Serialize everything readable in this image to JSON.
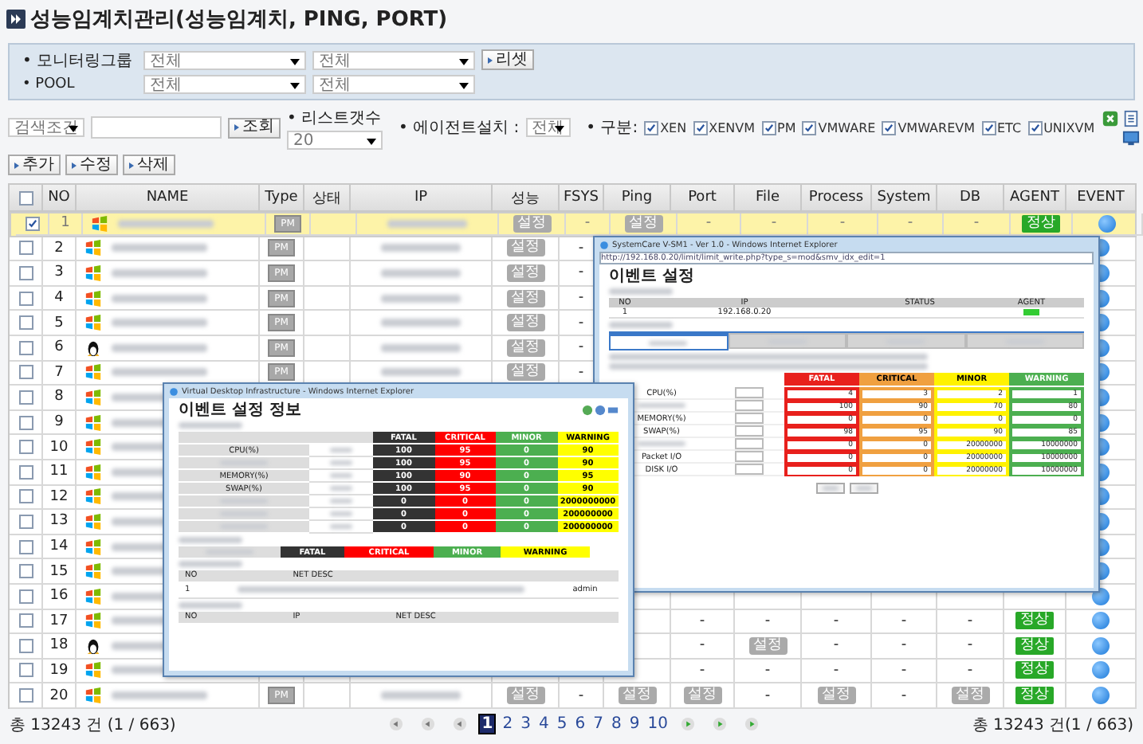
{
  "title": "성능임계치관리(성능임계치, PING, PORT)",
  "filters": {
    "group_label": "• 모니터링그룹",
    "group_selects": [
      "전체",
      "전체"
    ],
    "reset_button": "리셋",
    "pool_label": "• POOL",
    "pool_selects": [
      "전체",
      "전체"
    ]
  },
  "search": {
    "condition": "검색조건",
    "search_button": "조회",
    "list_count_label": "• 리스트갯수",
    "list_count": "20",
    "agent_label": "• 에이전트설치 :",
    "agent_value": "전체",
    "category_label": "• 구분:",
    "categories": [
      {
        "label": "XEN",
        "checked": true
      },
      {
        "label": "XENVM",
        "checked": true
      },
      {
        "label": "PM",
        "checked": true
      },
      {
        "label": "VMWARE",
        "checked": true
      },
      {
        "label": "VMWAREVM",
        "checked": true
      },
      {
        "label": "ETC",
        "checked": true
      },
      {
        "label": "UNIXVM",
        "checked": true
      }
    ]
  },
  "actions": [
    "추가",
    "수정",
    "삭제"
  ],
  "table": {
    "header_checked": false,
    "columns": [
      "NO",
      "NAME",
      "Type",
      "상태",
      "IP",
      "성능",
      "FSYS",
      "Ping",
      "Port",
      "File",
      "Process",
      "System",
      "DB",
      "AGENT",
      "EVENT"
    ],
    "rows": [
      {
        "no": "1",
        "checked": true,
        "selected": true,
        "kind": "windows",
        "type": "PM",
        "checks": {
          "perf": {
            "text": "설정",
            "kind": "badge"
          },
          "fsys": {
            "text": "-",
            "kind": "plain"
          },
          "ping": {
            "text": "설정",
            "kind": "badge"
          },
          "port": {
            "text": "-",
            "kind": "plain"
          },
          "file": {
            "text": "-",
            "kind": "plain"
          },
          "process": {
            "text": "-",
            "kind": "plain"
          },
          "system": {
            "text": "-",
            "kind": "plain"
          },
          "db": {
            "text": "-",
            "kind": "plain"
          }
        },
        "agent": "정상",
        "event": true
      },
      {
        "no": "2",
        "checked": false,
        "selected": false,
        "kind": "windows",
        "type": "PM",
        "checks": {
          "perf": {
            "text": "설정",
            "kind": "badge"
          },
          "fsys": {
            "text": "-",
            "kind": "plain"
          }
        },
        "event": true
      },
      {
        "no": "3",
        "checked": false,
        "selected": false,
        "kind": "windows",
        "type": "PM",
        "checks": {
          "perf": {
            "text": "설정",
            "kind": "badge"
          },
          "fsys": {
            "text": "-",
            "kind": "plain"
          }
        },
        "event": true
      },
      {
        "no": "4",
        "checked": false,
        "selected": false,
        "kind": "windows",
        "type": "PM",
        "checks": {
          "perf": {
            "text": "설정",
            "kind": "badge"
          },
          "fsys": {
            "text": "-",
            "kind": "plain"
          }
        },
        "event": true
      },
      {
        "no": "5",
        "checked": false,
        "selected": false,
        "kind": "windows",
        "type": "PM",
        "checks": {
          "perf": {
            "text": "설정",
            "kind": "badge"
          },
          "fsys": {
            "text": "-",
            "kind": "plain"
          }
        },
        "event": true
      },
      {
        "no": "6",
        "checked": false,
        "selected": false,
        "kind": "linux",
        "type": "PM",
        "checks": {
          "perf": {
            "text": "설정",
            "kind": "badge"
          },
          "fsys": {
            "text": "-",
            "kind": "plain"
          }
        },
        "event": true
      },
      {
        "no": "7",
        "checked": false,
        "selected": false,
        "kind": "windows",
        "type": "PM",
        "checks": {
          "perf": {
            "text": "설정",
            "kind": "badge"
          },
          "fsys": {
            "text": "-",
            "kind": "plain"
          }
        },
        "event": true
      },
      {
        "no": "8",
        "checked": false,
        "selected": false,
        "kind": "windows",
        "event": true
      },
      {
        "no": "9",
        "checked": false,
        "selected": false,
        "kind": "windows",
        "event": true
      },
      {
        "no": "10",
        "checked": false,
        "selected": false,
        "kind": "windows",
        "event": true
      },
      {
        "no": "11",
        "checked": false,
        "selected": false,
        "kind": "windows",
        "event": true
      },
      {
        "no": "12",
        "checked": false,
        "selected": false,
        "kind": "windows",
        "event": true
      },
      {
        "no": "13",
        "checked": false,
        "selected": false,
        "kind": "windows",
        "event": true
      },
      {
        "no": "14",
        "checked": false,
        "selected": false,
        "kind": "windows",
        "event": true
      },
      {
        "no": "15",
        "checked": false,
        "selected": false,
        "kind": "windows",
        "event": true
      },
      {
        "no": "16",
        "checked": false,
        "selected": false,
        "kind": "windows",
        "event": true
      },
      {
        "no": "17",
        "checked": false,
        "selected": false,
        "kind": "windows",
        "checks": {
          "port": {
            "text": "-",
            "kind": "plain"
          },
          "file": {
            "text": "-",
            "kind": "plain"
          },
          "process": {
            "text": "-",
            "kind": "plain"
          },
          "system": {
            "text": "-",
            "kind": "plain"
          },
          "db": {
            "text": "-",
            "kind": "plain"
          }
        },
        "agent": "정상",
        "event": true
      },
      {
        "no": "18",
        "checked": false,
        "selected": false,
        "kind": "linux",
        "checks": {
          "port": {
            "text": "-",
            "kind": "plain"
          },
          "file": {
            "text": "설정",
            "kind": "badge"
          },
          "process": {
            "text": "-",
            "kind": "plain"
          },
          "system": {
            "text": "-",
            "kind": "plain"
          },
          "db": {
            "text": "-",
            "kind": "plain"
          }
        },
        "agent": "정상",
        "event": true
      },
      {
        "no": "19",
        "checked": false,
        "selected": false,
        "kind": "windows",
        "checks": {
          "port": {
            "text": "-",
            "kind": "plain"
          },
          "file": {
            "text": "-",
            "kind": "plain"
          },
          "process": {
            "text": "-",
            "kind": "plain"
          },
          "system": {
            "text": "-",
            "kind": "plain"
          },
          "db": {
            "text": "-",
            "kind": "plain"
          }
        },
        "agent": "정상",
        "event": true
      },
      {
        "no": "20",
        "checked": false,
        "selected": false,
        "kind": "windows",
        "type": "PM",
        "checks": {
          "perf": {
            "text": "설정",
            "kind": "badge"
          },
          "fsys": {
            "text": "-",
            "kind": "plain"
          },
          "ping": {
            "text": "설정",
            "kind": "badge"
          },
          "port": {
            "text": "설정",
            "kind": "badge"
          },
          "file": {
            "text": "-",
            "kind": "plain"
          },
          "process": {
            "text": "설정",
            "kind": "badge"
          },
          "system": {
            "text": "-",
            "kind": "plain"
          },
          "db": {
            "text": "설정",
            "kind": "badge"
          }
        },
        "agent": "정상",
        "event": true
      }
    ]
  },
  "footer": {
    "total_left": "총 13243 건 (1 / 663)",
    "pages": [
      {
        "label": "1",
        "selected": true
      },
      {
        "label": "2",
        "selected": false
      },
      {
        "label": "3",
        "selected": false
      },
      {
        "label": "4",
        "selected": false
      },
      {
        "label": "5",
        "selected": false
      },
      {
        "label": "6",
        "selected": false
      },
      {
        "label": "7",
        "selected": false
      },
      {
        "label": "8",
        "selected": false
      },
      {
        "label": "9",
        "selected": false
      },
      {
        "label": "10",
        "selected": false
      }
    ],
    "total_right": "총 13243 건(1 / 663)"
  },
  "settings_window": {
    "title": "SystemCare V-SM1 - Ver 1.0 - Windows Internet Explorer",
    "url": "http://192.168.0.20/limit/limit_write.php?type_s=mod&smv_idx_edit=1",
    "heading": "이벤트 설정",
    "list_columns": [
      "NO",
      "IP",
      "STATUS",
      "AGENT"
    ],
    "list_row": {
      "no": "1",
      "ip": "192.168.0.20"
    },
    "tabs": [
      {
        "selected": true
      },
      {
        "selected": false
      },
      {
        "selected": false
      },
      {
        "selected": false
      }
    ],
    "levels": [
      {
        "label": "FATAL",
        "color": "#e8201c"
      },
      {
        "label": "CRITICAL",
        "color": "#f0a040"
      },
      {
        "label": "MINOR",
        "color": "#fff200"
      },
      {
        "label": "WARNING",
        "color": "#4caf50"
      }
    ],
    "rows": [
      {
        "label": "CPU(%)",
        "values": [
          "4",
          "3",
          "2",
          "1"
        ]
      },
      {
        "values": [
          "100",
          "90",
          "70",
          "80"
        ]
      },
      {
        "label": "MEMORY(%)",
        "values": [
          "0",
          "0",
          "0",
          "0"
        ]
      },
      {
        "label": "SWAP(%)",
        "values": [
          "98",
          "95",
          "90",
          "85"
        ]
      },
      {
        "values": [
          "0",
          "0",
          "20000000",
          "10000000"
        ]
      },
      {
        "label": "Packet I/O",
        "values": [
          "0",
          "0",
          "20000000",
          "10000000"
        ]
      },
      {
        "label": "DISK I/O",
        "values": [
          "0",
          "0",
          "20000000",
          "10000000"
        ]
      }
    ]
  },
  "info_window": {
    "title": "Virtual Desktop Infrastructure - Windows Internet Explorer",
    "heading": "이벤트 설정 정보",
    "levels": [
      {
        "label": "FATAL",
        "color": "#333333"
      },
      {
        "label": "CRITICAL",
        "color": "#ff0000"
      },
      {
        "label": "MINOR",
        "color": "#4caf50"
      },
      {
        "label": "WARNING",
        "color": "#ffff00"
      }
    ],
    "rows": [
      {
        "label": "CPU(%)",
        "values": [
          "100",
          "95",
          "0",
          "90"
        ]
      },
      {
        "values": [
          "100",
          "95",
          "0",
          "90"
        ]
      },
      {
        "label": "MEMORY(%)",
        "values": [
          "100",
          "90",
          "0",
          "95"
        ]
      },
      {
        "label": "SWAP(%)",
        "values": [
          "100",
          "95",
          "0",
          "90"
        ]
      },
      {
        "values": [
          "0",
          "0",
          "0",
          "2000000000"
        ]
      },
      {
        "values": [
          "0",
          "0",
          "0",
          "200000000"
        ]
      },
      {
        "values": [
          "0",
          "0",
          "0",
          "200000000"
        ]
      }
    ],
    "fs_levels": [
      {
        "label": "FATAL",
        "color": "#333333"
      },
      {
        "label": "CRITICAL",
        "color": "#ff0000"
      },
      {
        "label": "MINOR",
        "color": "#4caf50"
      },
      {
        "label": "WARNING",
        "color": "#ffff00"
      }
    ],
    "ping_columns": [
      "NO",
      "NET DESC"
    ],
    "ping_row": {
      "no": "1",
      "user": "admin"
    },
    "port_columns": [
      "NO",
      "IP",
      "NET DESC"
    ]
  }
}
